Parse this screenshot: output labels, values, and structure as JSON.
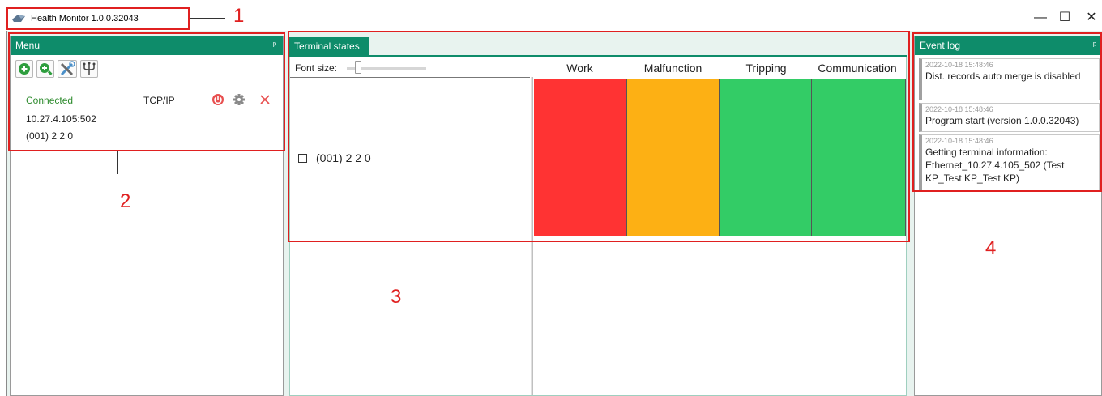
{
  "window": {
    "title": "Health Monitor 1.0.0.32043",
    "controls": {
      "minimize": "—",
      "maximize": "☐",
      "close": "✕"
    }
  },
  "menu": {
    "header": "Menu",
    "pin": "ᵖ",
    "toolbar": [
      {
        "icon": "add-circle-icon",
        "color": "#2e9e3e"
      },
      {
        "icon": "search-add-icon",
        "color": "#2e9e3e"
      },
      {
        "icon": "tools-icon",
        "color": "#4a8fc8"
      },
      {
        "icon": "usb-icon",
        "color": "#444444"
      }
    ],
    "connection": {
      "status": "Connected",
      "protocol": "TCP/IP",
      "address": "10.27.4.105:502",
      "terminal": "(001) 2 2 0",
      "power_color": "#e85050",
      "gear_color": "#8a8a8a",
      "close_color": "#e85050"
    }
  },
  "terminal_states": {
    "tab": "Terminal states",
    "font_size_label": "Font size:",
    "columns": [
      "Work",
      "Malfunction",
      "Tripping",
      "Communication"
    ],
    "terminals": [
      {
        "name": "(001) 2 2 0",
        "states": [
          "#ff3333",
          "#fdb014",
          "#33cc66",
          "#33cc66"
        ]
      }
    ]
  },
  "event_log": {
    "header": "Event log",
    "pin": "ᵖ",
    "events": [
      {
        "time": "2022-10-18 15:48:46",
        "text": "Dist. records auto merge is disabled"
      },
      {
        "time": "2022-10-18 15:48:46",
        "text": "Program start (version 1.0.0.32043)"
      },
      {
        "time": "2022-10-18 15:48:46",
        "text": "Getting terminal information: Ethernet_10.27.4.105_502 (Test KP_Test KP_Test KP)"
      }
    ]
  },
  "annotations": [
    "1",
    "2",
    "3",
    "4"
  ],
  "theme": {
    "accent": "#0e8c6a",
    "annotation": "#e02020"
  }
}
